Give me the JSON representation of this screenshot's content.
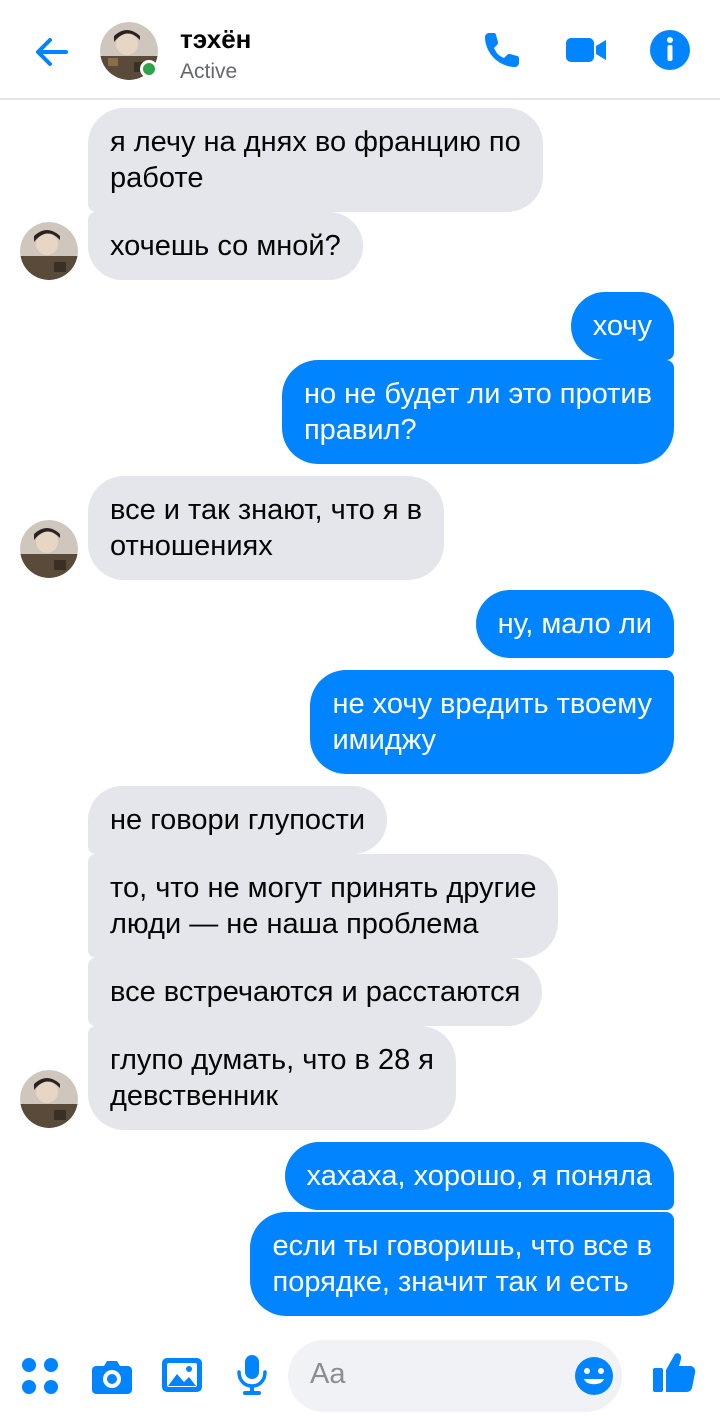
{
  "header": {
    "contact_name": "тэхён",
    "status": "Active",
    "accent": "#0084ff",
    "online_color": "#31a24c"
  },
  "messages": [
    {
      "side": "in",
      "lines": [
        "я лечу на днях во францию по",
        "работе"
      ]
    },
    {
      "side": "in",
      "lines": [
        "хочешь со мной?"
      ],
      "avatar": true
    },
    {
      "side": "out",
      "lines": [
        "хочу"
      ]
    },
    {
      "side": "out",
      "lines": [
        "но не будет ли это против",
        "правил?"
      ]
    },
    {
      "side": "in",
      "lines": [
        "все и так знают, что я в",
        "отношениях"
      ],
      "avatar": true
    },
    {
      "side": "out",
      "lines": [
        "ну, мало ли"
      ]
    },
    {
      "side": "out",
      "lines": [
        "не хочу вредить твоему",
        "имиджу"
      ]
    },
    {
      "side": "in",
      "lines": [
        "не говори глупости"
      ]
    },
    {
      "side": "in",
      "lines": [
        "то, что не могут принять другие",
        "люди — не наша проблема"
      ]
    },
    {
      "side": "in",
      "lines": [
        "все встречаются и расстаются"
      ]
    },
    {
      "side": "in",
      "lines": [
        "глупо думать, что в 28 я",
        "девственник"
      ],
      "avatar": true
    },
    {
      "side": "out",
      "lines": [
        "хахаха, хорошо, я поняла"
      ]
    },
    {
      "side": "out",
      "lines": [
        "если ты говоришь, что все в",
        "порядке, значит так и есть"
      ]
    }
  ],
  "composer": {
    "placeholder": "Aa",
    "icons": [
      "apps-icon",
      "camera-icon",
      "gallery-icon",
      "mic-icon",
      "emoji-icon",
      "like-icon"
    ]
  }
}
